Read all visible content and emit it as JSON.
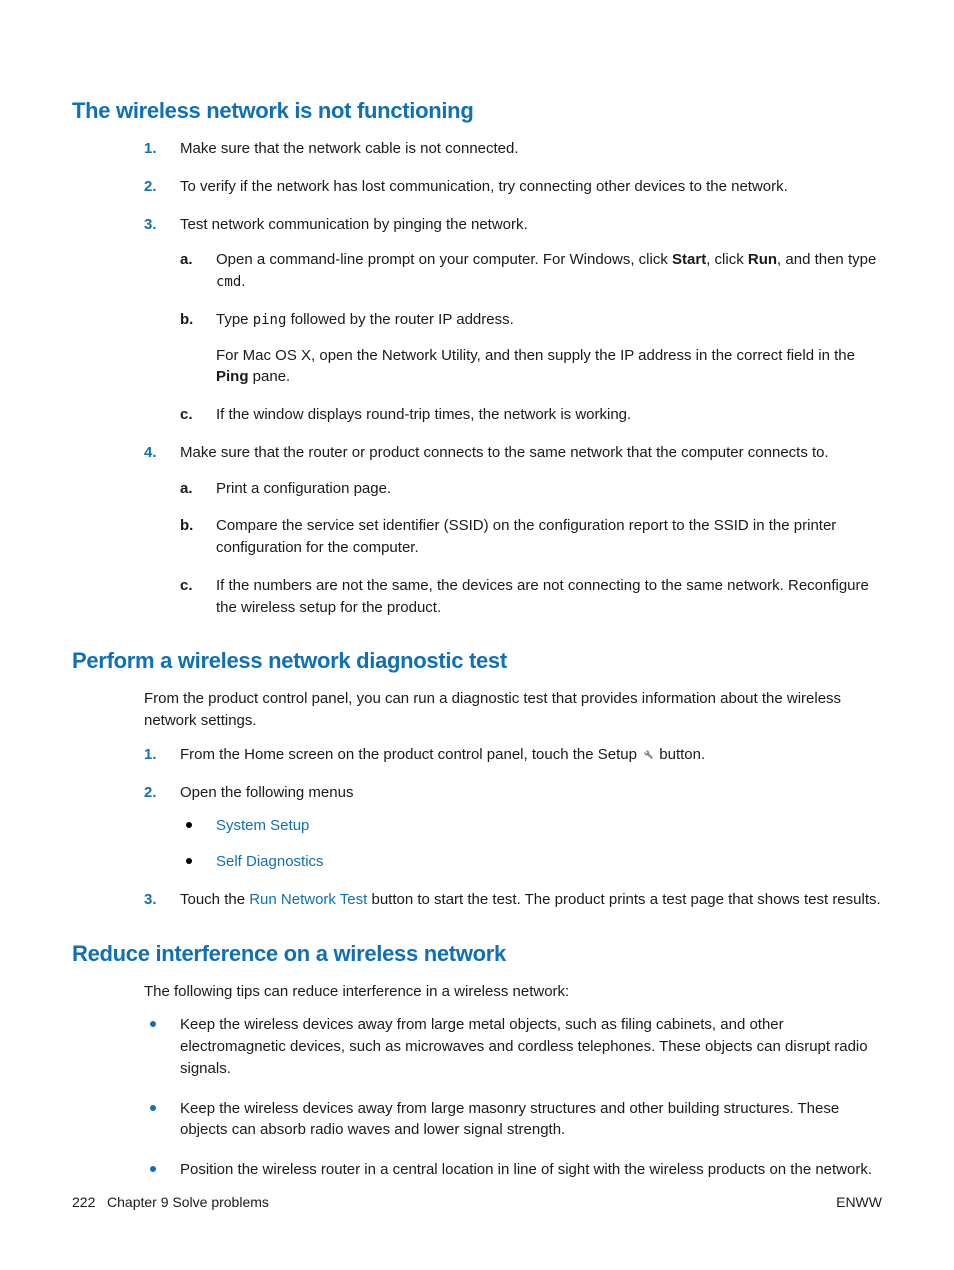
{
  "headings": {
    "wireless_not_functioning": "The wireless network is not functioning",
    "diagnostic_test": "Perform a wireless network diagnostic test",
    "reduce_interference": "Reduce interference on a wireless network"
  },
  "sec1": {
    "step1": "Make sure that the network cable is not connected.",
    "step2": "To verify if the network has lost communication, try connecting other devices to the network.",
    "step3": "Test network communication by pinging the network.",
    "step3a_pre": "Open a command-line prompt on your computer. For Windows, click ",
    "start": "Start",
    "comma_click": ", click ",
    "run": "Run",
    "step3a_post": ", and then type ",
    "cmd": "cmd",
    "period": ".",
    "step3b_pre": "Type ",
    "ping": "ping",
    "step3b_post": " followed by the router IP address.",
    "step3b_mac_pre": "For Mac OS X, open the Network Utility, and then supply the IP address in the correct field in the ",
    "ping_pane": "Ping",
    "step3b_mac_post": " pane.",
    "step3c": "If the window displays round-trip times, the network is working.",
    "step4": "Make sure that the router or product connects to the same network that the computer connects to.",
    "step4a": "Print a configuration page.",
    "step4b": "Compare the service set identifier (SSID) on the configuration report to the SSID in the printer configuration for the computer.",
    "step4c": "If the numbers are not the same, the devices are not connecting to the same network. Reconfigure the wireless setup for the product."
  },
  "sec2": {
    "intro": "From the product control panel, you can run a diagnostic test that provides information about the wireless network settings.",
    "step1_pre": "From the Home screen on the product control panel, touch the Setup ",
    "step1_post": " button.",
    "step2": "Open the following menus",
    "menu1": "System Setup",
    "menu2": "Self Diagnostics",
    "step3_pre": "Touch the ",
    "run_network_test": "Run Network Test",
    "step3_post": " button to start the test. The product prints a test page that shows test results."
  },
  "sec3": {
    "intro": "The following tips can reduce interference in a wireless network:",
    "tip1": "Keep the wireless devices away from large metal objects, such as filing cabinets, and other electromagnetic devices, such as microwaves and cordless telephones. These objects can disrupt radio signals.",
    "tip2": "Keep the wireless devices away from large masonry structures and other building structures. These objects can absorb radio waves and lower signal strength.",
    "tip3": "Position the wireless router in a central location in line of sight with the wireless products on the network."
  },
  "footer": {
    "left_page": "222",
    "left_chapter": "Chapter 9   Solve problems",
    "right": "ENWW"
  },
  "markers": {
    "n1": "1.",
    "n2": "2.",
    "n3": "3.",
    "n4": "4.",
    "a": "a.",
    "b": "b.",
    "c": "c."
  }
}
